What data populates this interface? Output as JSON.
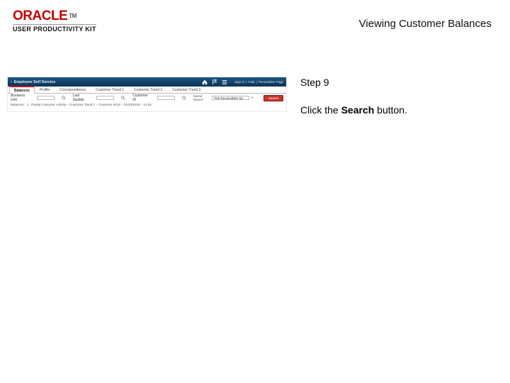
{
  "brand": {
    "name": "ORACLE",
    "tm": "TM",
    "subtitle": "USER PRODUCTIVITY KIT"
  },
  "page_title": "Viewing Customer Balances",
  "instruction": {
    "step_label": "Step 9",
    "text_prefix": "Click the ",
    "button_name": "Search",
    "text_suffix": " button."
  },
  "shot": {
    "back_glyph": "‹",
    "header_title": "Employee Self Service",
    "util": {
      "item1": "Sign In",
      "sep": "|",
      "item2": "Help",
      "item3": "Personalize Page"
    },
    "tabs": [
      "Balances",
      "Profile",
      "Correspondence",
      "Customer Trend 1",
      "Customer Trend 2",
      "Customer Trend 3"
    ],
    "filters": {
      "label1": "Business Unit",
      "label2": "Last Update",
      "label3": "Customer ID",
      "saved_label": "Saved Search",
      "saved_value": "Test Receivables Sp",
      "action_label": "Search"
    },
    "meta": {
      "prefix": "Balances:",
      "val": "1 - Partial Customer Activity – Customer Trend 1 – Customer 0012 – 01/23/2019 – 14:53"
    }
  }
}
